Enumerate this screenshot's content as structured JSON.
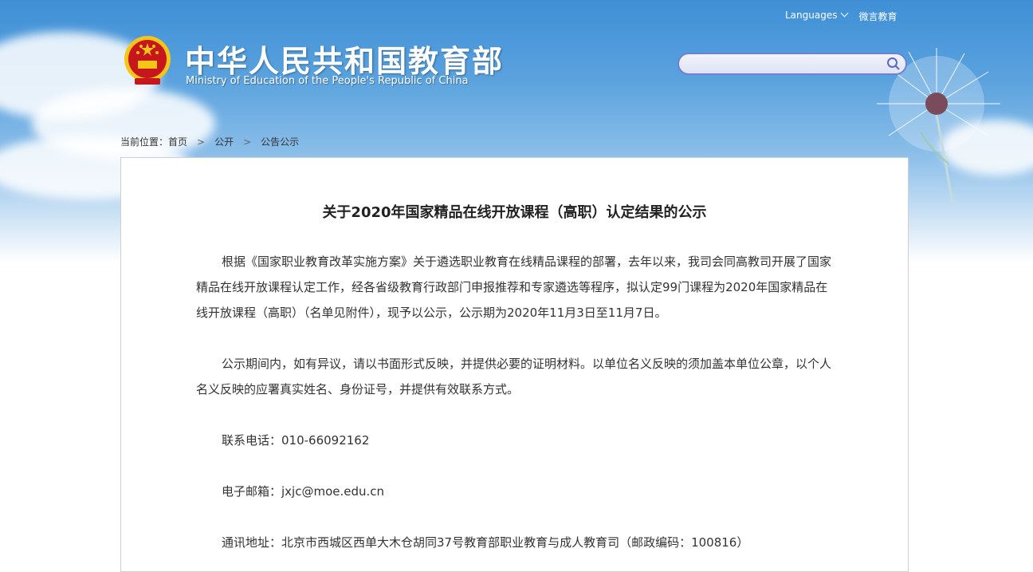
{
  "header": {
    "languages_label": "Languages",
    "weibo_label": "微言教育",
    "site_title": "中华人民共和国教育部",
    "site_subtitle": "Ministry of Education of the People's Republic of China",
    "search_placeholder": ""
  },
  "breadcrumb": {
    "prefix": "当前位置：",
    "items": [
      "首页",
      "公开",
      "公告公示"
    ],
    "separator": ">"
  },
  "article": {
    "title": "关于2020年国家精品在线开放课程（高职）认定结果的公示",
    "paragraphs": [
      "根据《国家职业教育改革实施方案》关于遴选职业教育在线精品课程的部署，去年以来，我司会同高教司开展了国家精品在线开放课程认定工作，经各省级教育行政部门申报推荐和专家遴选等程序，拟认定99门课程为2020年国家精品在线开放课程（高职）（名单见附件），现予以公示，公示期为2020年11月3日至11月7日。",
      "公示期间内，如有异议，请以书面形式反映，并提供必要的证明材料。以单位名义反映的须加盖本单位公章，以个人名义反映的应署真实姓名、身份证号，并提供有效联系方式。",
      "联系电话：010-66092162",
      "电子邮箱：jxjc@moe.edu.cn",
      "通讯地址：北京市西城区西单大木仓胡同37号教育部职业教育与成人教育司（邮政编码：100816）"
    ]
  },
  "colors": {
    "sky_top": "#3f8fd6",
    "search_border": "#6f7fd4",
    "emblem_red": "#c8161d",
    "emblem_gold": "#f5c518"
  }
}
